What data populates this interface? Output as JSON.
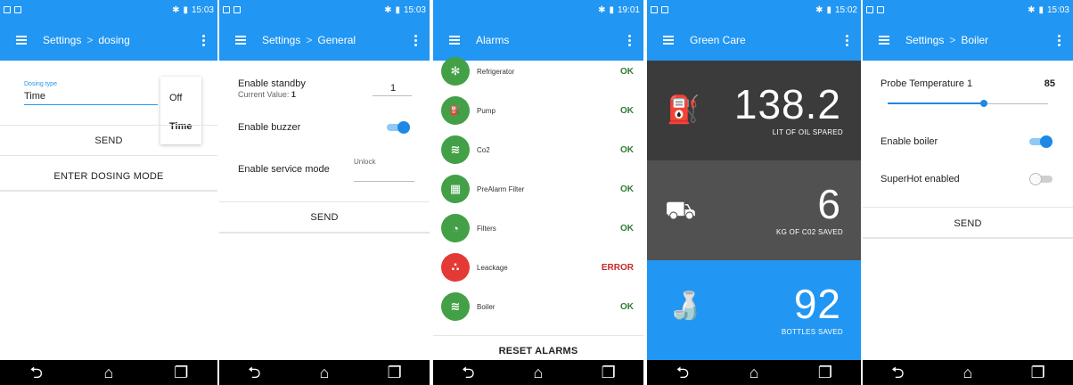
{
  "status": {
    "phone1_time": "15:03",
    "phone2_time": "15:03",
    "phone3_time": "19:01",
    "phone4_time": "15:02",
    "phone5_time": "15:03"
  },
  "dosing": {
    "crumb_root": "Settings",
    "crumb_sep": ">",
    "crumb_page": "dosing",
    "field_label": "Dosing type",
    "field_value": "Time",
    "menu_options": [
      "Off",
      "Time"
    ],
    "send": "SEND",
    "enter_mode": "ENTER DOSING MODE"
  },
  "general": {
    "crumb_root": "Settings",
    "crumb_sep": ">",
    "crumb_page": "General",
    "standby_label": "Enable standby",
    "standby_current": "Current Value:",
    "standby_current_value": "1",
    "standby_input": "1",
    "buzzer_label": "Enable buzzer",
    "service_label": "Enable service mode",
    "unlock_label": "Unlock",
    "send": "SEND"
  },
  "alarms": {
    "title": "Alarms",
    "items": [
      {
        "name": "Refrigerator",
        "status": "OK",
        "icon": "snowflake-icon",
        "color": "#43a047"
      },
      {
        "name": "Pump",
        "status": "OK",
        "icon": "pump-icon",
        "color": "#43a047"
      },
      {
        "name": "Co2",
        "status": "OK",
        "icon": "heat-waves-icon",
        "color": "#43a047"
      },
      {
        "name": "PreAlarm Filter",
        "status": "OK",
        "icon": "grid-filter-icon",
        "color": "#43a047"
      },
      {
        "name": "Filters",
        "status": "OK",
        "icon": "gauge-icon",
        "color": "#43a047"
      },
      {
        "name": "Leackage",
        "status": "ERROR",
        "icon": "leak-drops-icon",
        "color": "#e53935"
      },
      {
        "name": "Boiler",
        "status": "OK",
        "icon": "heat-waves-icon",
        "color": "#43a047"
      }
    ],
    "ok_color": "#2e7d32",
    "error_color": "#c62828",
    "reset": "RESET ALARMS"
  },
  "greencare": {
    "title": "Green Care",
    "oil_value": "138.2",
    "oil_label": "LIT OF OIL SPARED",
    "co2_value": "6",
    "co2_label": "KG OF C02 SAVED",
    "bottles_value": "92",
    "bottles_label": "BOTTLES SAVED",
    "colors": {
      "panel1": "#3b3b3b",
      "panel2": "#515151",
      "panel3": "#2196f3"
    }
  },
  "boiler": {
    "crumb_root": "Settings",
    "crumb_sep": ">",
    "crumb_page": "Boiler",
    "probe_label": "Probe Temperature 1",
    "probe_value": "85",
    "probe_fraction": 0.6,
    "enable_boiler": "Enable boiler",
    "enable_boiler_on": true,
    "superhot": "SuperHot enabled",
    "superhot_on": false,
    "send": "SEND"
  },
  "theme": {
    "accent": "#2196f3",
    "navbar": "#000000"
  }
}
